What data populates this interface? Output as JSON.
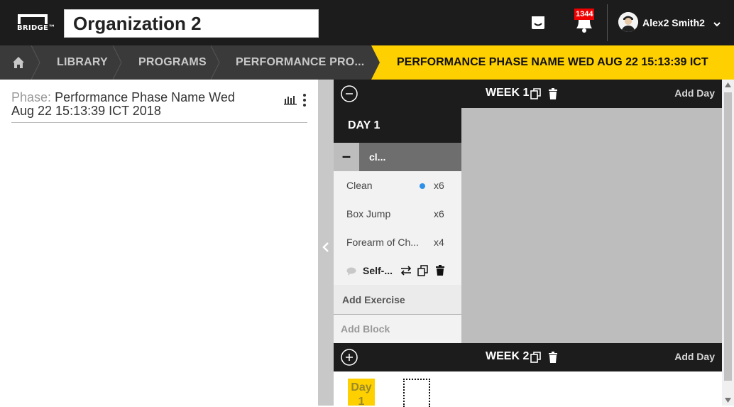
{
  "app": {
    "logo_text": "BRIDGE™",
    "organization": "Organization 2",
    "notification_count": "1344",
    "user_name": "Alex2 Smith2"
  },
  "breadcrumb": {
    "items": [
      "LIBRARY",
      "PROGRAMS",
      "PERFORMANCE PRO..."
    ],
    "active": "PERFORMANCE PHASE NAME WED AUG 22 15:13:39 ICT 2018"
  },
  "phase": {
    "label": "Phase:",
    "name": "Performance Phase Name Wed Aug 22 15:13:39 ICT 2018"
  },
  "weeks": [
    {
      "title": "WEEK 1",
      "add_day": "Add Day",
      "day": {
        "title": "DAY 1",
        "block_name": "cl...",
        "exercises": [
          {
            "name": "Clean",
            "reps": "x6",
            "has_dot": true
          },
          {
            "name": "Box Jump",
            "reps": "x6",
            "has_dot": false
          },
          {
            "name": "Forearm of Ch...",
            "reps": "x4",
            "has_dot": false
          }
        ],
        "note": "Self-...",
        "add_exercise": "Add Exercise",
        "add_block": "Add Block"
      }
    },
    {
      "title": "WEEK 2",
      "add_day": "Add Day",
      "day_chip": "Day 1"
    }
  ],
  "colors": {
    "accent": "#ffd000",
    "topbar": "#1c1c1c",
    "crumbbar": "#3a3a3a",
    "badge": "#ee0000",
    "dot": "#2e90e8"
  }
}
